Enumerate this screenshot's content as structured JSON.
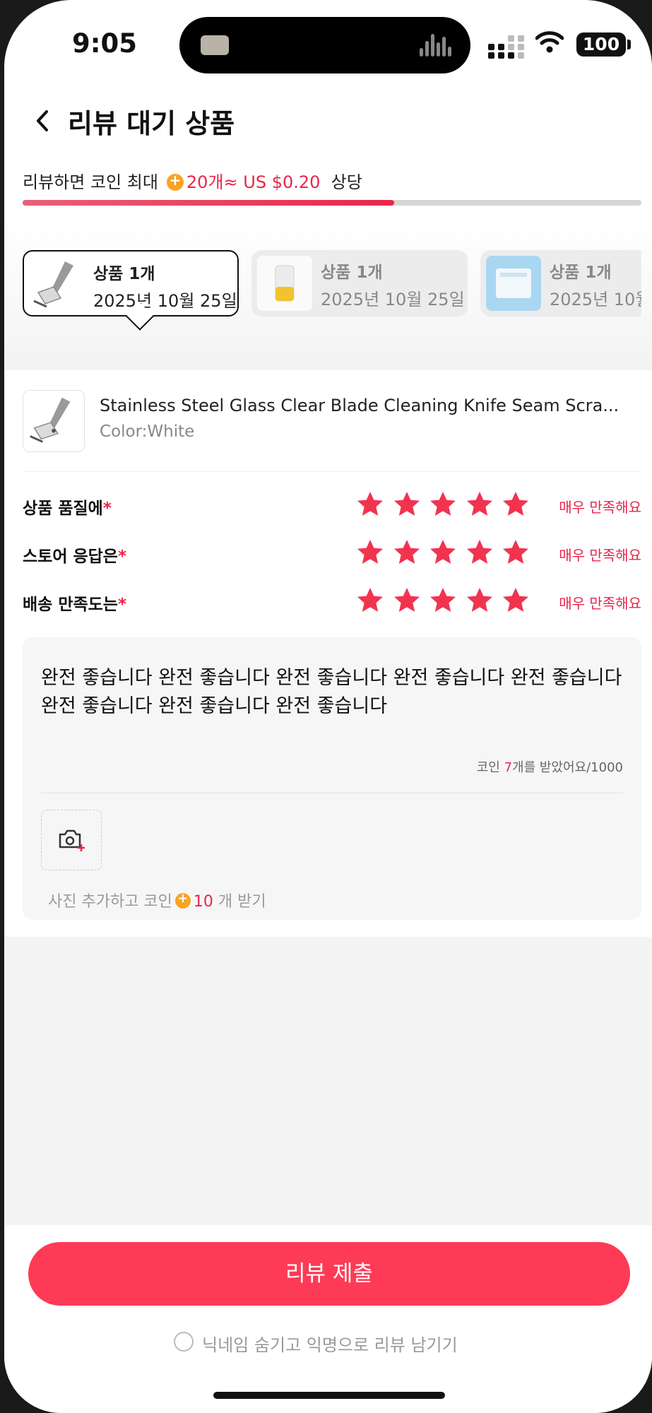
{
  "status_bar": {
    "time": "9:05",
    "battery": "100"
  },
  "header": {
    "title": "리뷰 대기 상품"
  },
  "reward": {
    "prefix": "리뷰하면 코인 최대",
    "amount": "20개≈ US $0.20",
    "suffix": "상당",
    "progress": 0.6
  },
  "product_tabs": [
    {
      "title": "상품 1개",
      "date": "2025년 10월 25일"
    },
    {
      "title": "상품 1개",
      "date": "2025년 10월 25일"
    },
    {
      "title": "상품 1개",
      "date": "2025년 10월"
    }
  ],
  "product": {
    "name": "Stainless Steel Glass Clear Blade Cleaning Knife Seam Scra...",
    "variant": "Color:White"
  },
  "ratings": [
    {
      "label": "상품 품질에",
      "required": "*",
      "stars": 5,
      "text": "매우 만족해요"
    },
    {
      "label": "스토어 응답은",
      "required": "*",
      "stars": 5,
      "text": "매우 만족해요"
    },
    {
      "label": "배송 만족도는",
      "required": "*",
      "stars": 5,
      "text": "매우 만족해요"
    }
  ],
  "review": {
    "text": "완전 좋습니다 완전 좋습니다 완전 좋습니다 완전 좋습니다 완전 좋습니다 완전 좋습니다 완전 좋습니다 완전 좋습니다",
    "coin_prefix": "코인 ",
    "coin_count": "7",
    "coin_suffix": "개를 받았어요/1000",
    "photo_prefix": "사진 추가하고 코인",
    "photo_coins": "10",
    "photo_suffix": "개 받기"
  },
  "bottom": {
    "submit_label": "리뷰 제출",
    "anonymous_label": "닉네임 숨기고 익명으로 리뷰 남기기"
  },
  "colors": {
    "accent": "#fd3b56",
    "star": "#f2334f",
    "coin": "#f7a425"
  },
  "icons": {
    "back": "chevron-left-icon",
    "camera": "camera-plus-icon",
    "star": "star-icon",
    "coin": "coin-icon"
  }
}
